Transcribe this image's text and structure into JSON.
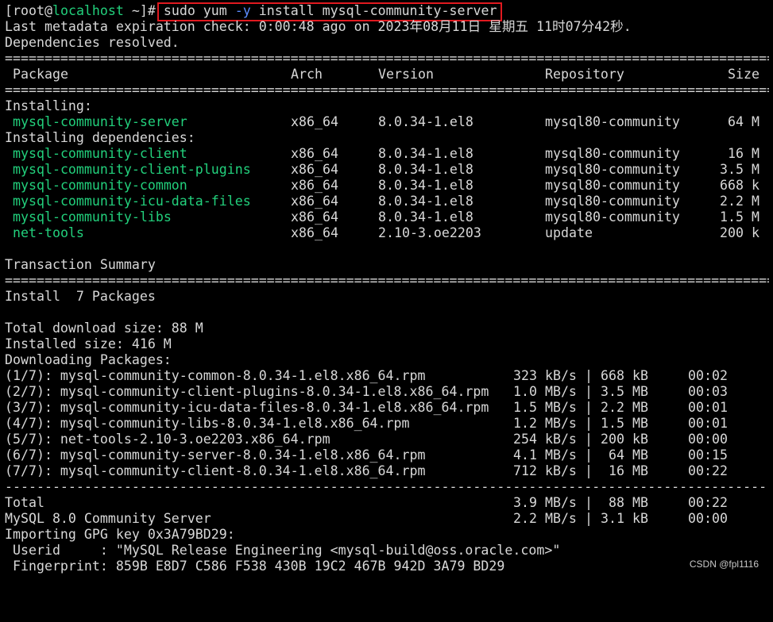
{
  "terminal": {
    "prompt": {
      "open": "[",
      "user": "root",
      "at": "@",
      "host": "localhost",
      "cwd_end": " ~]# ",
      "cmd_pre": "sudo yum ",
      "cmd_flag": "-y",
      "cmd_post": " install mysql-community-server"
    },
    "meta_line": "Last metadata expiration check: 0:00:48 ago on 2023年08月11日 星期五 11时07分42秒.",
    "deps_resolved": "Dependencies resolved.",
    "rule_double": "==================================================================================================",
    "rule_dash": "--------------------------------------------------------------------------------------------------",
    "headers": {
      "package": "Package",
      "arch": "Arch",
      "version": "Version",
      "repository": "Repository",
      "size": "Size"
    },
    "installing_label": "Installing:",
    "installing": [
      {
        "name": "mysql-community-server",
        "arch": "x86_64",
        "version": "8.0.34-1.el8",
        "repo": "mysql80-community",
        "size": "64 M"
      }
    ],
    "deps_label": "Installing dependencies:",
    "dependencies": [
      {
        "name": "mysql-community-client",
        "arch": "x86_64",
        "version": "8.0.34-1.el8",
        "repo": "mysql80-community",
        "size": "16 M"
      },
      {
        "name": "mysql-community-client-plugins",
        "arch": "x86_64",
        "version": "8.0.34-1.el8",
        "repo": "mysql80-community",
        "size": "3.5 M"
      },
      {
        "name": "mysql-community-common",
        "arch": "x86_64",
        "version": "8.0.34-1.el8",
        "repo": "mysql80-community",
        "size": "668 k"
      },
      {
        "name": "mysql-community-icu-data-files",
        "arch": "x86_64",
        "version": "8.0.34-1.el8",
        "repo": "mysql80-community",
        "size": "2.2 M"
      },
      {
        "name": "mysql-community-libs",
        "arch": "x86_64",
        "version": "8.0.34-1.el8",
        "repo": "mysql80-community",
        "size": "1.5 M"
      },
      {
        "name": "net-tools",
        "arch": "x86_64",
        "version": "2.10-3.oe2203",
        "repo": "update",
        "size": "200 k"
      }
    ],
    "transaction_summary": "Transaction Summary",
    "install_count": "Install  7 Packages",
    "total_download": "Total download size: 88 M",
    "installed_size": "Installed size: 416 M",
    "downloading": "Downloading Packages:",
    "downloads": [
      {
        "file": "(1/7): mysql-community-common-8.0.34-1.el8.x86_64.rpm",
        "rate": "323 kB/s",
        "sep": "|",
        "size": "668 kB",
        "time": "00:02"
      },
      {
        "file": "(2/7): mysql-community-client-plugins-8.0.34-1.el8.x86_64.rpm",
        "rate": "1.0 MB/s",
        "sep": "|",
        "size": "3.5 MB",
        "time": "00:03"
      },
      {
        "file": "(3/7): mysql-community-icu-data-files-8.0.34-1.el8.x86_64.rpm",
        "rate": "1.5 MB/s",
        "sep": "|",
        "size": "2.2 MB",
        "time": "00:01"
      },
      {
        "file": "(4/7): mysql-community-libs-8.0.34-1.el8.x86_64.rpm",
        "rate": "1.2 MB/s",
        "sep": "|",
        "size": "1.5 MB",
        "time": "00:01"
      },
      {
        "file": "(5/7): net-tools-2.10-3.oe2203.x86_64.rpm",
        "rate": "254 kB/s",
        "sep": "|",
        "size": "200 kB",
        "time": "00:00"
      },
      {
        "file": "(6/7): mysql-community-server-8.0.34-1.el8.x86_64.rpm",
        "rate": "4.1 MB/s",
        "sep": "|",
        "size": "64 MB",
        "time": "00:15"
      },
      {
        "file": "(7/7): mysql-community-client-8.0.34-1.el8.x86_64.rpm",
        "rate": "712 kB/s",
        "sep": "|",
        "size": "16 MB",
        "time": "00:22"
      }
    ],
    "total": {
      "label": "Total",
      "rate": "3.9 MB/s",
      "sep": "|",
      "size": "88 MB",
      "time": "00:22"
    },
    "mysql_line": {
      "label": "MySQL 8.0 Community Server",
      "rate": "2.2 MB/s",
      "sep": "|",
      "size": "3.1 kB",
      "time": "00:00"
    },
    "gpg_import": "Importing GPG key 0x3A79BD29:",
    "userid": " Userid     : \"MySQL Release Engineering <mysql-build@oss.oracle.com>\"",
    "fingerprint": " Fingerprint: 859B E8D7 C586 F538 430B 19C2 467B 942D 3A79 BD29",
    "colors": {
      "background": "#000000",
      "text": "#d8d8d8",
      "package": "#22d07c",
      "flag": "#5c8cff",
      "highlight": "#e0191f"
    }
  },
  "watermark": "CSDN @fpl1116"
}
